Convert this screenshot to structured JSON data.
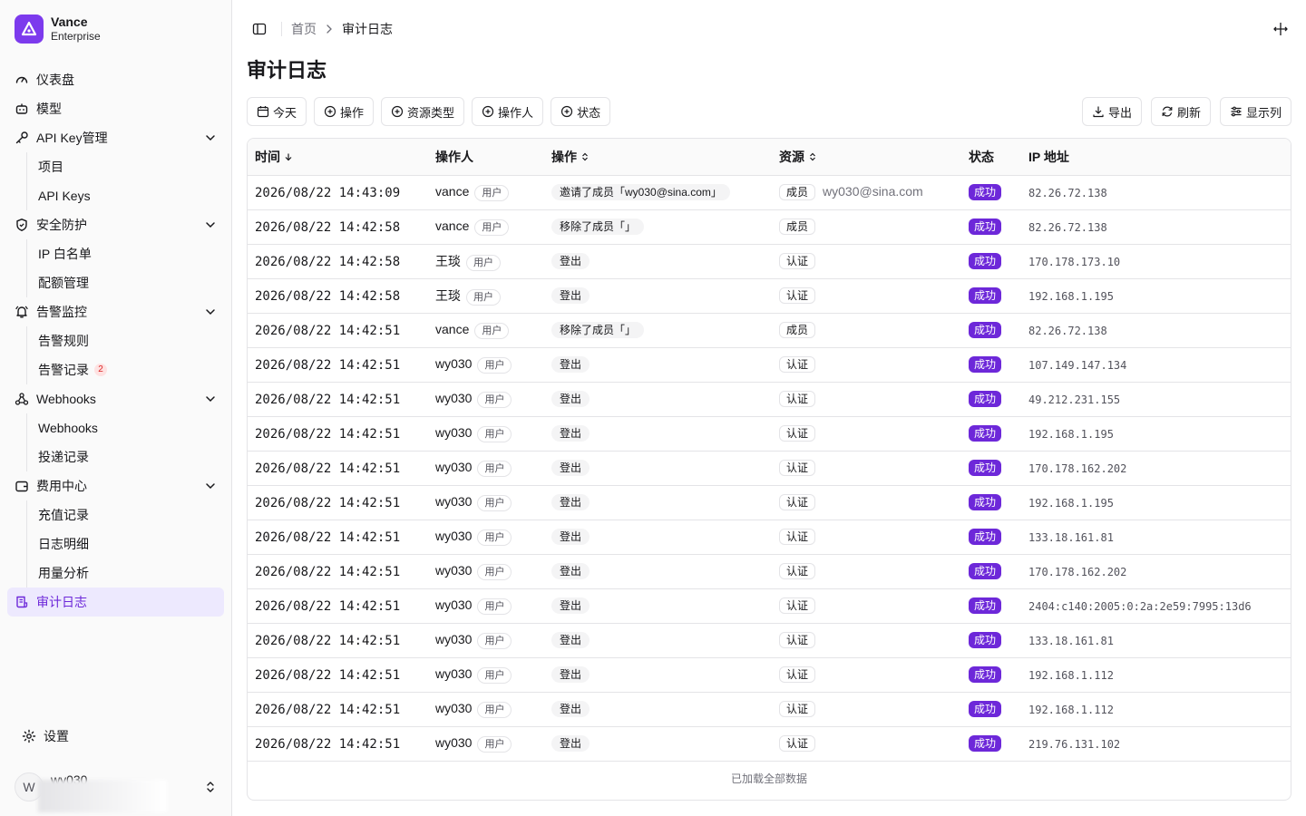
{
  "brand": {
    "name": "Vance",
    "subtitle": "Enterprise"
  },
  "sidebar": {
    "items": [
      {
        "label": "仪表盘",
        "icon": "gauge-icon"
      },
      {
        "label": "模型",
        "icon": "robot-icon"
      },
      {
        "label": "API Key管理",
        "icon": "key-icon",
        "children": [
          "项目",
          "API Keys"
        ]
      },
      {
        "label": "安全防护",
        "icon": "shield-icon",
        "children": [
          "IP 白名单",
          "配额管理"
        ]
      },
      {
        "label": "告警监控",
        "icon": "bell-icon",
        "children": [
          "告警规则",
          "告警记录"
        ],
        "alert_badge": "2"
      },
      {
        "label": "Webhooks",
        "icon": "webhook-icon",
        "children": [
          "Webhooks",
          "投递记录"
        ]
      },
      {
        "label": "费用中心",
        "icon": "wallet-icon",
        "children": [
          "充值记录",
          "日志明细",
          "用量分析"
        ]
      },
      {
        "label": "审计日志",
        "icon": "audit-log-icon",
        "active": true
      }
    ],
    "settings_label": "设置",
    "user": {
      "initial": "W",
      "name": "wy030"
    }
  },
  "breadcrumb": {
    "home": "首页",
    "current": "审计日志"
  },
  "page_title": "审计日志",
  "toolbar": {
    "filters": [
      "今天",
      "操作",
      "资源类型",
      "操作人",
      "状态"
    ],
    "export_label": "导出",
    "refresh_label": "刷新",
    "columns_label": "显示列"
  },
  "table": {
    "headers": {
      "time": "时间",
      "operator": "操作人",
      "action": "操作",
      "resource": "资源",
      "status": "状态",
      "ip": "IP 地址"
    },
    "rows": [
      {
        "time": "2026/08/22 14:43:09",
        "operator": "vance",
        "role": "用户",
        "action": "邀请了成员「wy030@sina.com」",
        "resource": "成员",
        "resource_detail": "wy030@sina.com",
        "status": "成功",
        "ip": "82.26.72.138"
      },
      {
        "time": "2026/08/22 14:42:58",
        "operator": "vance",
        "role": "用户",
        "action": "移除了成员「」",
        "resource": "成员",
        "resource_detail": "",
        "status": "成功",
        "ip": "82.26.72.138"
      },
      {
        "time": "2026/08/22 14:42:58",
        "operator": "王琰",
        "role": "用户",
        "action": "登出",
        "resource": "认证",
        "resource_detail": "",
        "status": "成功",
        "ip": "170.178.173.10"
      },
      {
        "time": "2026/08/22 14:42:58",
        "operator": "王琰",
        "role": "用户",
        "action": "登出",
        "resource": "认证",
        "resource_detail": "",
        "status": "成功",
        "ip": "192.168.1.195"
      },
      {
        "time": "2026/08/22 14:42:51",
        "operator": "vance",
        "role": "用户",
        "action": "移除了成员「」",
        "resource": "成员",
        "resource_detail": "",
        "status": "成功",
        "ip": "82.26.72.138"
      },
      {
        "time": "2026/08/22 14:42:51",
        "operator": "wy030",
        "role": "用户",
        "action": "登出",
        "resource": "认证",
        "resource_detail": "",
        "status": "成功",
        "ip": "107.149.147.134"
      },
      {
        "time": "2026/08/22 14:42:51",
        "operator": "wy030",
        "role": "用户",
        "action": "登出",
        "resource": "认证",
        "resource_detail": "",
        "status": "成功",
        "ip": "49.212.231.155"
      },
      {
        "time": "2026/08/22 14:42:51",
        "operator": "wy030",
        "role": "用户",
        "action": "登出",
        "resource": "认证",
        "resource_detail": "",
        "status": "成功",
        "ip": "192.168.1.195"
      },
      {
        "time": "2026/08/22 14:42:51",
        "operator": "wy030",
        "role": "用户",
        "action": "登出",
        "resource": "认证",
        "resource_detail": "",
        "status": "成功",
        "ip": "170.178.162.202"
      },
      {
        "time": "2026/08/22 14:42:51",
        "operator": "wy030",
        "role": "用户",
        "action": "登出",
        "resource": "认证",
        "resource_detail": "",
        "status": "成功",
        "ip": "192.168.1.195"
      },
      {
        "time": "2026/08/22 14:42:51",
        "operator": "wy030",
        "role": "用户",
        "action": "登出",
        "resource": "认证",
        "resource_detail": "",
        "status": "成功",
        "ip": "133.18.161.81"
      },
      {
        "time": "2026/08/22 14:42:51",
        "operator": "wy030",
        "role": "用户",
        "action": "登出",
        "resource": "认证",
        "resource_detail": "",
        "status": "成功",
        "ip": "170.178.162.202"
      },
      {
        "time": "2026/08/22 14:42:51",
        "operator": "wy030",
        "role": "用户",
        "action": "登出",
        "resource": "认证",
        "resource_detail": "",
        "status": "成功",
        "ip": "2404:c140:2005:0:2a:2e59:7995:13d6"
      },
      {
        "time": "2026/08/22 14:42:51",
        "operator": "wy030",
        "role": "用户",
        "action": "登出",
        "resource": "认证",
        "resource_detail": "",
        "status": "成功",
        "ip": "133.18.161.81"
      },
      {
        "time": "2026/08/22 14:42:51",
        "operator": "wy030",
        "role": "用户",
        "action": "登出",
        "resource": "认证",
        "resource_detail": "",
        "status": "成功",
        "ip": "192.168.1.112"
      },
      {
        "time": "2026/08/22 14:42:51",
        "operator": "wy030",
        "role": "用户",
        "action": "登出",
        "resource": "认证",
        "resource_detail": "",
        "status": "成功",
        "ip": "192.168.1.112"
      },
      {
        "time": "2026/08/22 14:42:51",
        "operator": "wy030",
        "role": "用户",
        "action": "登出",
        "resource": "认证",
        "resource_detail": "",
        "status": "成功",
        "ip": "219.76.131.102"
      }
    ],
    "footer": "已加载全部数据"
  },
  "colors": {
    "accent": "#6d28d9",
    "accent_bg": "#ede9fe",
    "brand": "#7c3aed",
    "alert": "#dc2626"
  }
}
